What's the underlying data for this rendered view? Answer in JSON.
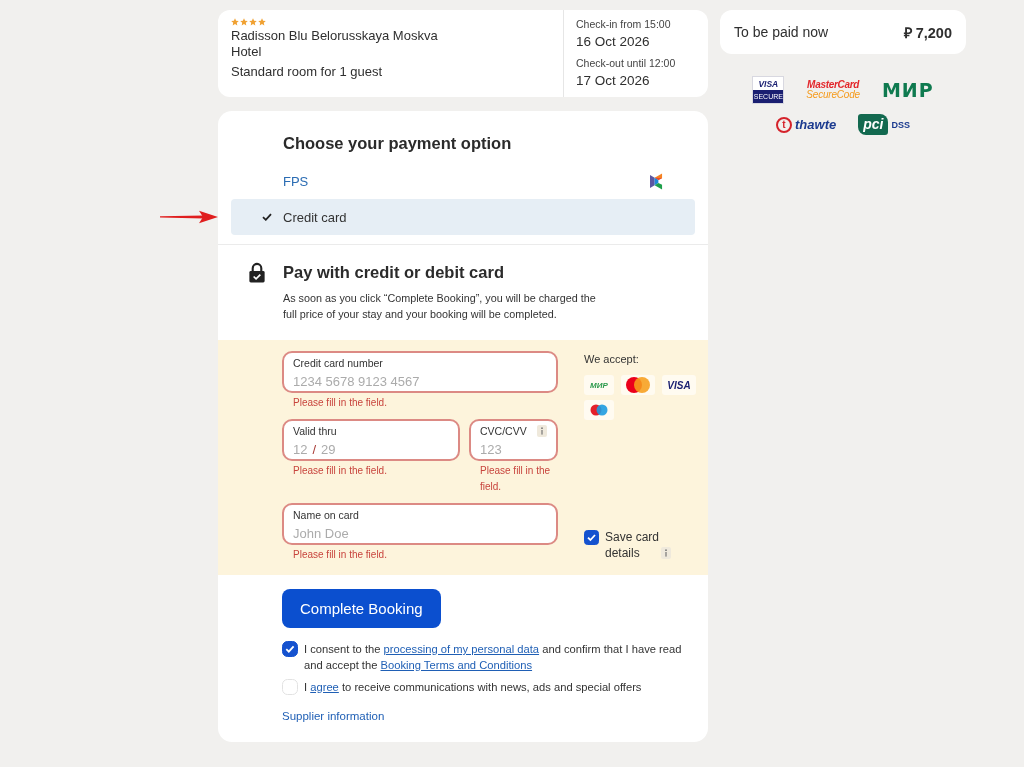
{
  "hotel": {
    "stars": 4,
    "name": "Radisson Blu Belorusskaya Moskva Hotel",
    "room": "Standard room for 1 guest",
    "dates": [
      {
        "label": "Check-in from 15:00",
        "date": "16 Oct 2026"
      },
      {
        "label": "Check-out until 12:00",
        "date": "17 Oct 2026"
      }
    ]
  },
  "summary": {
    "label": "To be paid now",
    "amount": "₽ 7,200"
  },
  "security_logos": [
    {
      "kind": "visa_secure",
      "text": "VISA",
      "subtext": "SECURE"
    },
    {
      "kind": "mastercard_securecode",
      "text": "MasterCard",
      "subtext": "SecureCode"
    },
    {
      "kind": "mir",
      "text": "МИР"
    },
    {
      "kind": "thawte",
      "mark": "t",
      "text": "thawte"
    },
    {
      "kind": "pci_dss",
      "text": "pci",
      "subtext": "DSS"
    }
  ],
  "payment_options": {
    "title": "Choose your payment option",
    "options": [
      {
        "kind": "fps",
        "label": "FPS",
        "selected": false
      },
      {
        "kind": "card",
        "label": "Credit card",
        "selected": true
      }
    ]
  },
  "card_payment": {
    "title": "Pay with credit or debit card",
    "description": "As soon as you click “Complete Booking”, you will be charged the full price of your stay and your booking will be completed.",
    "fields": [
      {
        "kind": "card_number",
        "label": "Credit card number",
        "placeholder": "1234 5678 9123 4567",
        "info_icon": false,
        "error": "Please fill in the field."
      },
      {
        "kind": "expiry",
        "label": "Valid thru",
        "month_placeholder": "12",
        "separator": "/",
        "year_placeholder": "29",
        "info_icon": false,
        "error": "Please fill in the field."
      },
      {
        "kind": "cvc",
        "label": "CVC/CVV",
        "placeholder": "123",
        "info_icon": true,
        "error": "Please fill in the field."
      },
      {
        "kind": "name",
        "label": "Name on card",
        "placeholder": "John Doe",
        "info_icon": false,
        "error": "Please fill in the field."
      }
    ],
    "accepted": {
      "label": "We accept:",
      "cards": [
        {
          "kind": "mir",
          "text": "МИР"
        },
        {
          "kind": "mastercard"
        },
        {
          "kind": "visa",
          "text": "VISA"
        },
        {
          "kind": "maestro"
        }
      ]
    },
    "save_card": {
      "label": "Save card details",
      "checked": true,
      "info_icon": true
    }
  },
  "complete_button": "Complete Booking",
  "consents": [
    {
      "checked": true,
      "parts": [
        {
          "kind": "text",
          "text": "I consent to the "
        },
        {
          "kind": "link",
          "text": "processing of my personal data"
        },
        {
          "kind": "text",
          "text": " and confirm that I have read and accept the "
        },
        {
          "kind": "link",
          "text": "Booking Terms and Conditions"
        }
      ]
    },
    {
      "checked": false,
      "parts": [
        {
          "kind": "text",
          "text": "I "
        },
        {
          "kind": "link",
          "text": "agree"
        },
        {
          "kind": "text",
          "text": " to receive communications with news, ads and special offers"
        }
      ]
    }
  ],
  "supplier_link": "Supplier information"
}
